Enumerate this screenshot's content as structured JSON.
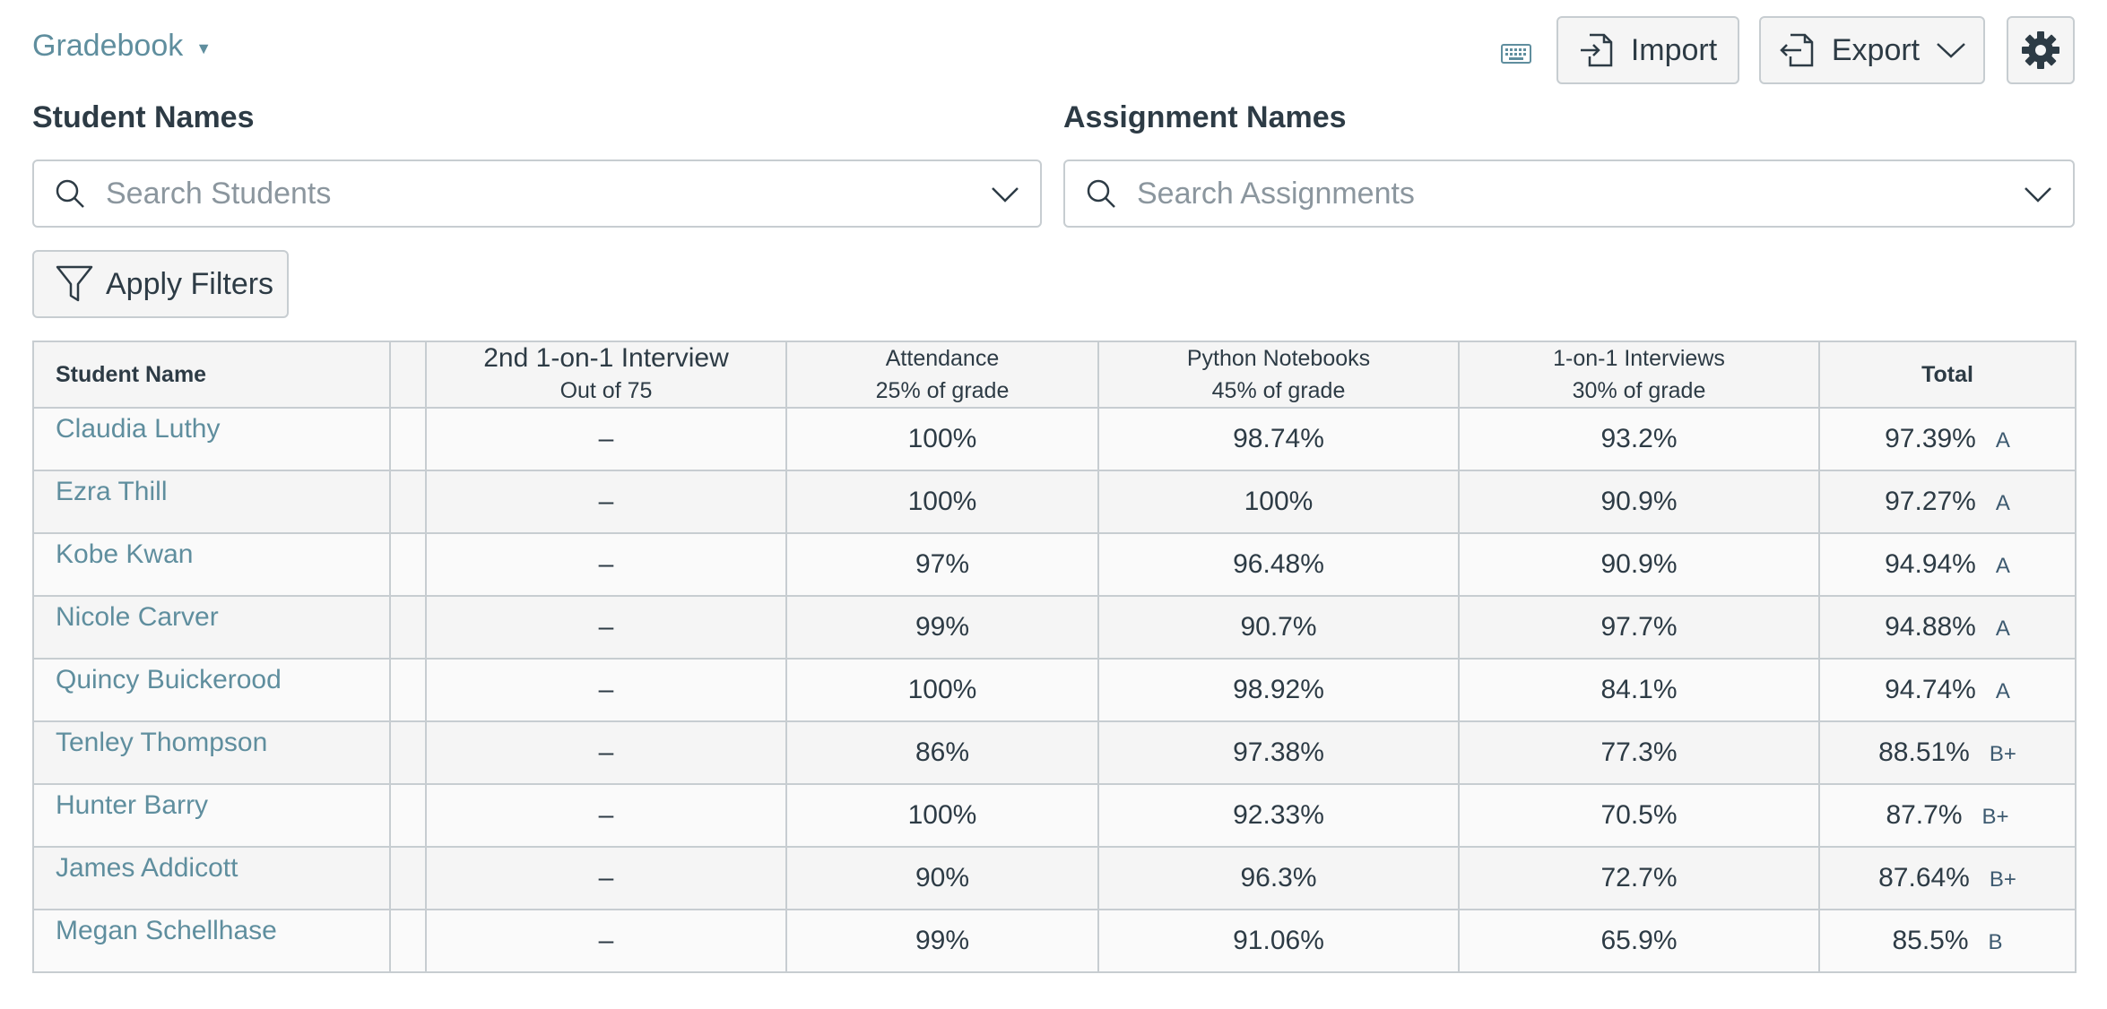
{
  "header": {
    "title": "Gradebook",
    "keyboard_icon": "keyboard-icon",
    "import_label": "Import",
    "export_label": "Export"
  },
  "filters": {
    "student_label": "Student Names",
    "student_placeholder": "Search Students",
    "assignment_label": "Assignment Names",
    "assignment_placeholder": "Search Assignments",
    "apply_label": "Apply Filters"
  },
  "table": {
    "columns": [
      {
        "title": "Student Name",
        "subtitle": ""
      },
      {
        "title": "",
        "subtitle": ""
      },
      {
        "title": "2nd 1-on-1 Interview",
        "subtitle": "Out of 75"
      },
      {
        "title": "Attendance",
        "subtitle": "25% of grade"
      },
      {
        "title": "Python Notebooks",
        "subtitle": "45% of grade"
      },
      {
        "title": "1-on-1 Interviews",
        "subtitle": "30% of grade"
      },
      {
        "title": "Total",
        "subtitle": ""
      }
    ],
    "rows": [
      {
        "name": "Claudia Luthy",
        "interview2": "–",
        "attendance": "100%",
        "python": "98.74%",
        "interviews": "93.2%",
        "total": "97.39%",
        "letter": "A"
      },
      {
        "name": "Ezra Thill",
        "interview2": "–",
        "attendance": "100%",
        "python": "100%",
        "interviews": "90.9%",
        "total": "97.27%",
        "letter": "A"
      },
      {
        "name": "Kobe Kwan",
        "interview2": "–",
        "attendance": "97%",
        "python": "96.48%",
        "interviews": "90.9%",
        "total": "94.94%",
        "letter": "A"
      },
      {
        "name": "Nicole Carver",
        "interview2": "–",
        "attendance": "99%",
        "python": "90.7%",
        "interviews": "97.7%",
        "total": "94.88%",
        "letter": "A"
      },
      {
        "name": "Quincy Buickerood",
        "interview2": "–",
        "attendance": "100%",
        "python": "98.92%",
        "interviews": "84.1%",
        "total": "94.74%",
        "letter": "A"
      },
      {
        "name": "Tenley Thompson",
        "interview2": "–",
        "attendance": "86%",
        "python": "97.38%",
        "interviews": "77.3%",
        "total": "88.51%",
        "letter": "B+"
      },
      {
        "name": "Hunter Barry",
        "interview2": "–",
        "attendance": "100%",
        "python": "92.33%",
        "interviews": "70.5%",
        "total": "87.7%",
        "letter": "B+"
      },
      {
        "name": "James Addicott",
        "interview2": "–",
        "attendance": "90%",
        "python": "96.3%",
        "interviews": "72.7%",
        "total": "87.64%",
        "letter": "B+"
      },
      {
        "name": "Megan Schellhase",
        "interview2": "–",
        "attendance": "99%",
        "python": "91.06%",
        "interviews": "65.9%",
        "total": "85.5%",
        "letter": "B"
      }
    ]
  },
  "colors": {
    "link": "#5f8e9e",
    "text": "#2d3b45",
    "border": "#c7cdd1",
    "button_bg": "#f5f5f5"
  }
}
